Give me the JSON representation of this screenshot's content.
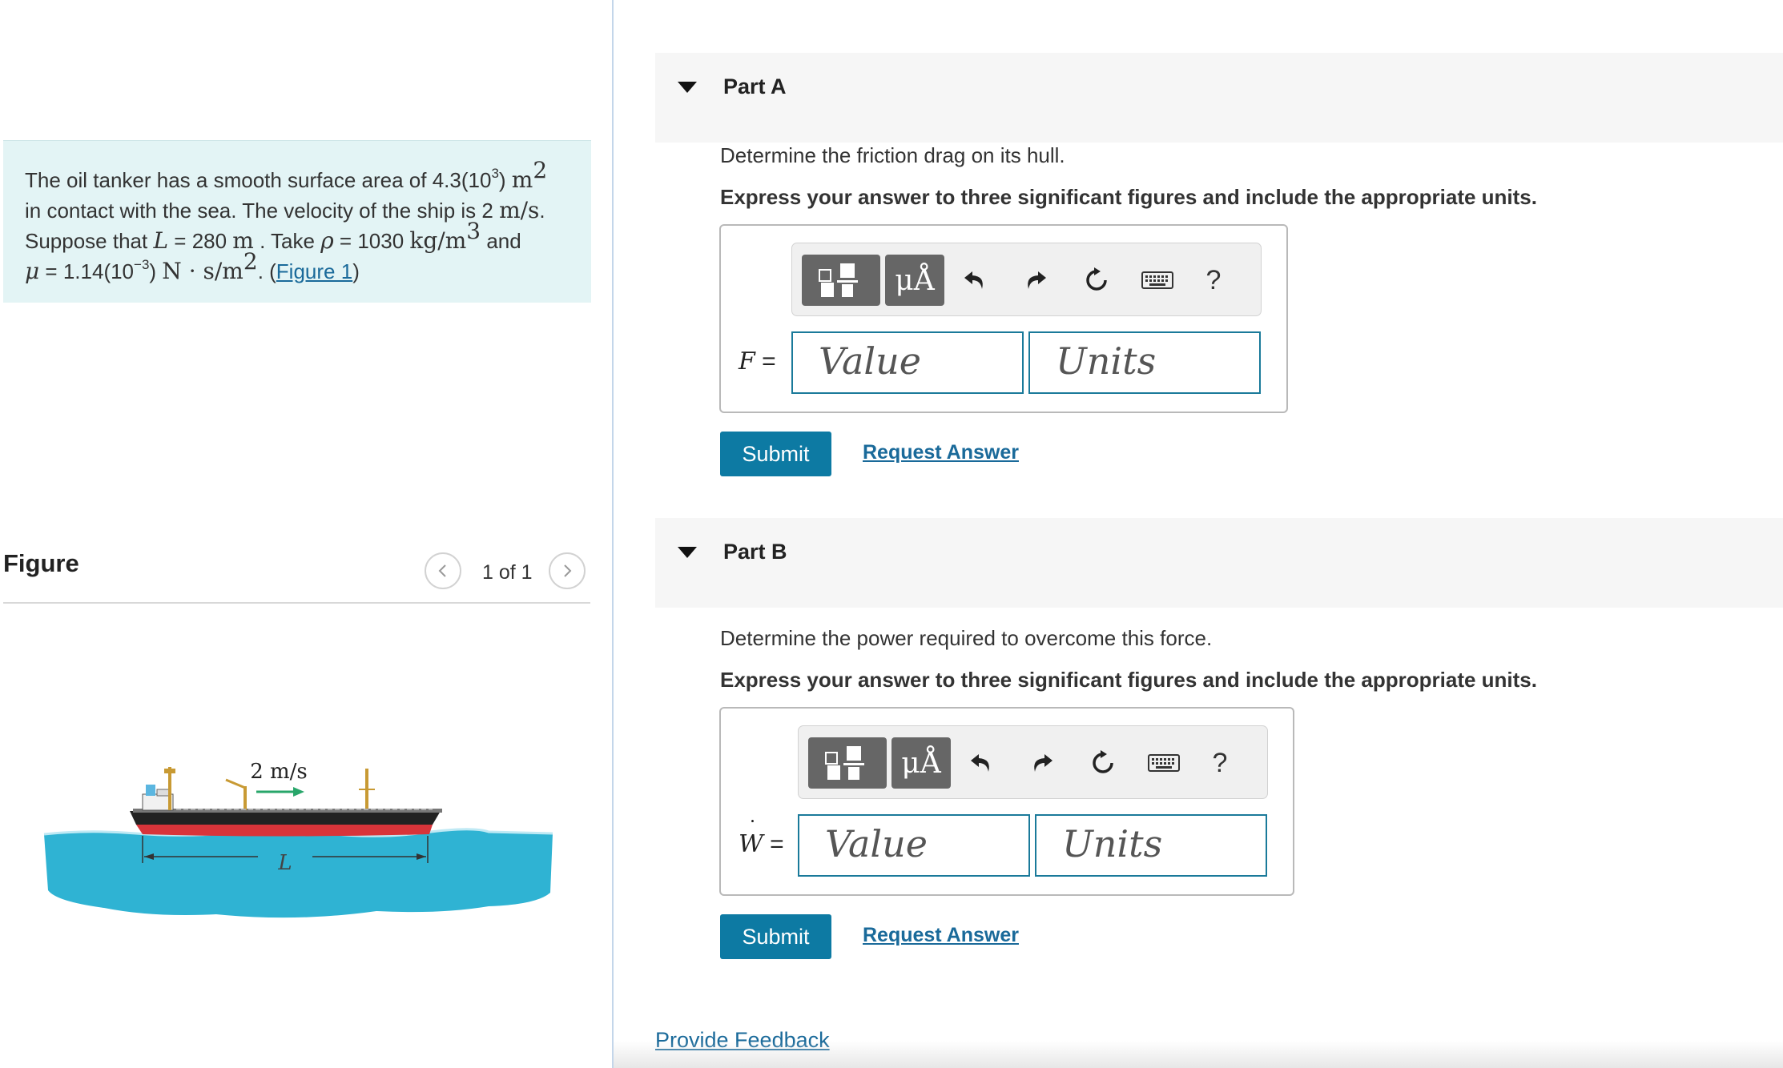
{
  "problem": {
    "line1_a": "The oil tanker has a smooth surface area of 4.3(10",
    "line1_exp": "3",
    "line1_b": ") ",
    "line1_unit": "m",
    "line1_unit_exp": "2",
    "line2_a": "in contact with the sea. The velocity of the ship is 2 ",
    "line2_unit": "m/s",
    "line2_b": ".",
    "line3_a": "Suppose that ",
    "line3_var": "L",
    "line3_b": " = 280 ",
    "line3_unit": "m",
    "line3_c": " . Take ",
    "line3_rho": "ρ",
    "line3_d": " = 1030 ",
    "line3_unit2": "kg/m",
    "line3_unit2_exp": "3",
    "line3_e": " and",
    "line4_mu": "μ",
    "line4_a": " = 1.14(10",
    "line4_exp": "−3",
    "line4_b": ") ",
    "line4_unit": "N · s/m",
    "line4_unit_exp": "2",
    "line4_c": ". (",
    "figure_link": "Figure 1",
    "line4_d": ")"
  },
  "figure": {
    "title": "Figure",
    "pager": "1 of 1",
    "speed_label": "2 m/s",
    "length_label": "L"
  },
  "toolbar": {
    "units_symbol": "μÅ",
    "help": "?"
  },
  "partA": {
    "label": "Part A",
    "question": "Determine the friction drag on its hull.",
    "instruction": "Express your answer to three significant figures and include the appropriate units.",
    "answer_label": "F",
    "equals": " =",
    "value_placeholder": "Value",
    "units_placeholder": "Units",
    "submit": "Submit",
    "request": "Request Answer"
  },
  "partB": {
    "label": "Part B",
    "question": "Determine the power required to overcome this force.",
    "instruction": "Express your answer to three significant figures and include the appropriate units.",
    "answer_label": "W",
    "equals": " =",
    "value_placeholder": "Value",
    "units_placeholder": "Units",
    "submit": "Submit",
    "request": "Request Answer"
  },
  "feedback": "Provide Feedback"
}
